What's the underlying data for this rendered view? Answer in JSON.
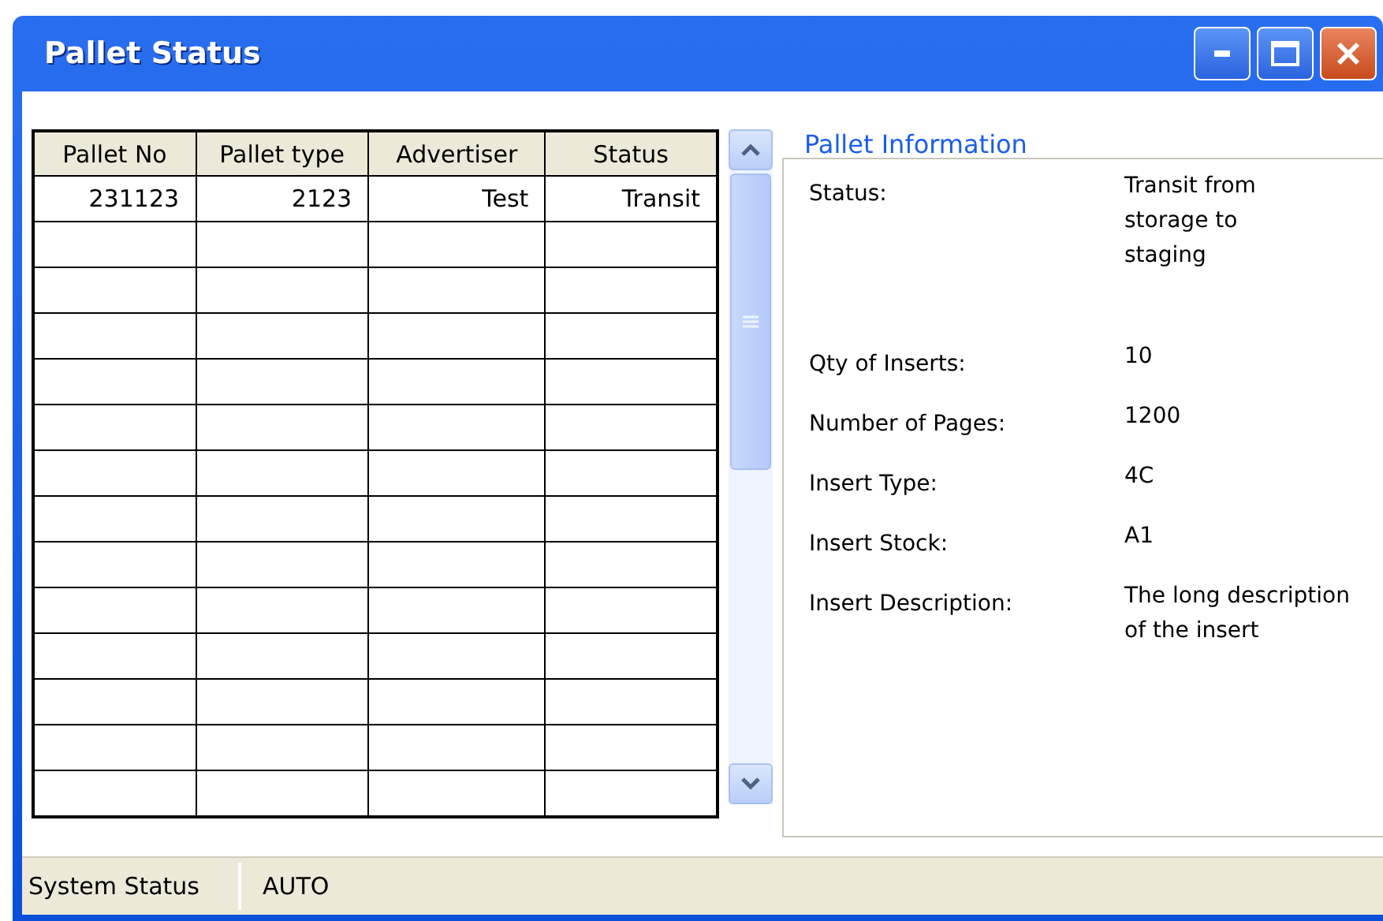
{
  "window": {
    "title": "Pallet Status"
  },
  "table": {
    "columns": [
      "Pallet No",
      "Pallet type",
      "Advertiser",
      "Status"
    ],
    "rows": [
      [
        "231123",
        "2123",
        "Test",
        "Transit"
      ]
    ]
  },
  "info": {
    "title": "Pallet Information",
    "fields": [
      {
        "label": "Status:",
        "value": "Transit from storage to staging"
      },
      {
        "label": "Qty of Inserts:",
        "value": "10"
      },
      {
        "label": "Number of Pages:",
        "value": "1200"
      },
      {
        "label": "Insert Type:",
        "value": "4C"
      },
      {
        "label": "Insert Stock:",
        "value": "A1"
      },
      {
        "label": "Insert Description:",
        "value": "The long description of the insert"
      }
    ]
  },
  "status_bar": {
    "label": "System Status",
    "value": "AUTO"
  }
}
